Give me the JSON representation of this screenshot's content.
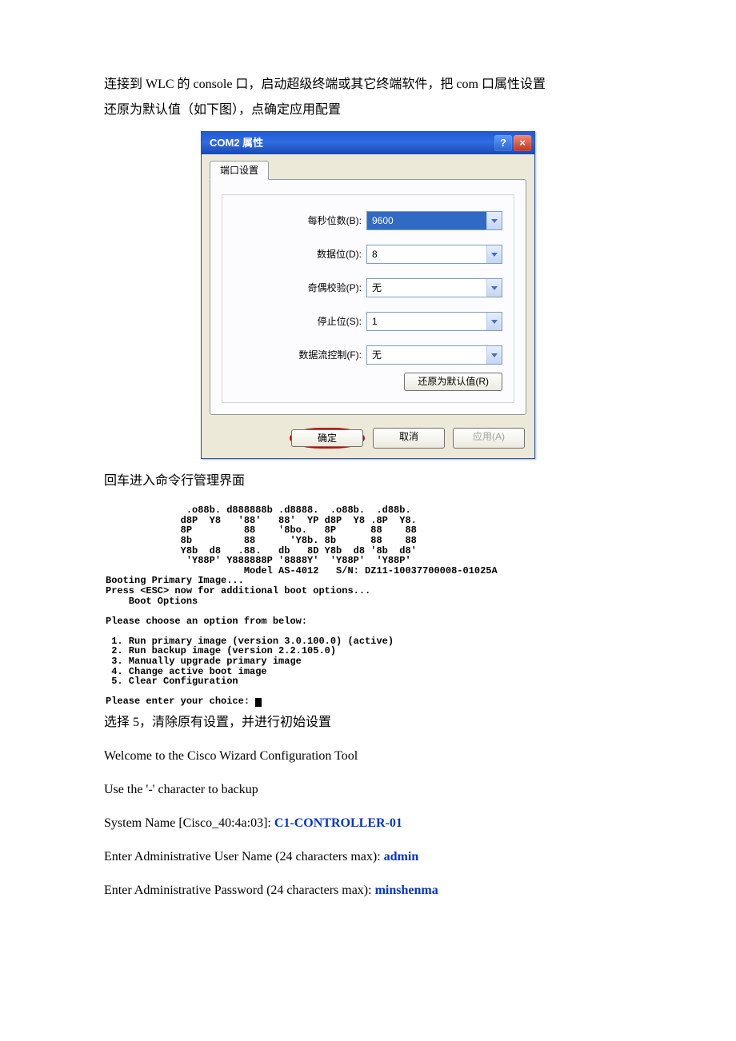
{
  "intro": {
    "line1": "连接到 WLC 的 console 口，启动超级终端或其它终端软件，把 com 口属性设置",
    "line2": "还原为默认值（如下图），点确定应用配置"
  },
  "dialog": {
    "title": "COM2 属性",
    "help": "?",
    "close": "×",
    "tab": "端口设置",
    "fields": {
      "baud": {
        "label": "每秒位数(B):",
        "value": "9600"
      },
      "data": {
        "label": "数据位(D):",
        "value": "8"
      },
      "parity": {
        "label": "奇偶校验(P):",
        "value": "无"
      },
      "stop": {
        "label": "停止位(S):",
        "value": "1"
      },
      "flow": {
        "label": "数据流控制(F):",
        "value": "无"
      }
    },
    "restore": "还原为默认值(R)",
    "ok": "确定",
    "cancel": "取消",
    "apply": "应用(A)"
  },
  "after_dialog": "回车进入命令行管理界面",
  "boot_ascii": "              .o88b. d888888b .d8888.  .o88b.  .d88b.\n             d8P  Y8   '88'   88'  YP d8P  Y8 .8P  Y8.\n             8P         88    '8bo.   8P      88    88\n             8b         88      'Y8b. 8b      88    88\n             Y8b  d8   .88.   db   8D Y8b  d8 '8b  d8'\n              'Y88P' Y888888P '8888Y'  'Y88P'  'Y88P'\n                        Model AS-4012   S/N: DZ11-10037700008-01025A\nBooting Primary Image...\nPress <ESC> now for additional boot options...\n    Boot Options\n\nPlease choose an option from below:\n\n 1. Run primary image (version 3.0.100.0) (active)\n 2. Run backup image (version 2.2.105.0)\n 3. Manually upgrade primary image\n 4. Change active boot image\n 5. Clear Configuration\n\nPlease enter your choice: ",
  "after_boot": "选择 5，清除原有设置，并进行初始设置",
  "wizard": {
    "welcome": "Welcome to the Cisco Wizard Configuration Tool",
    "backup_hint": "Use the '-' character to backup",
    "sysname_label": "System Name [Cisco_40:4a:03]: ",
    "sysname_value": "C1-CONTROLLER-01",
    "user_label": "Enter Administrative User Name (24 characters max): ",
    "user_value": "admin",
    "pass_label": "Enter Administrative Password (24 characters max): ",
    "pass_value": "minshenma"
  }
}
